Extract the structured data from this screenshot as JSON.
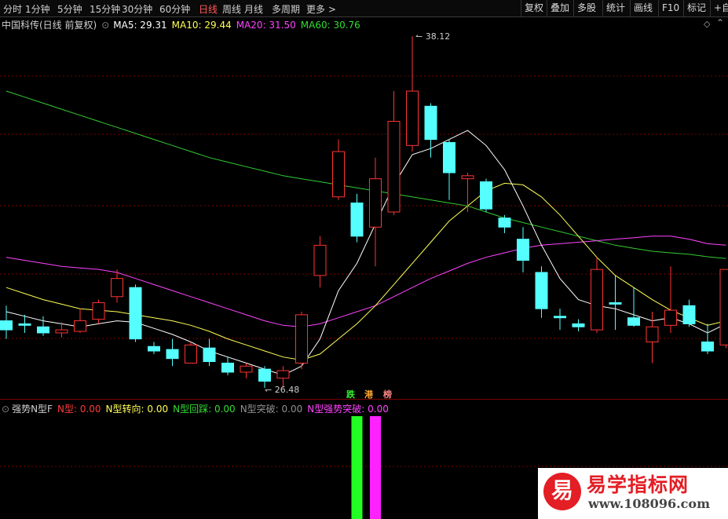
{
  "toolbar": {
    "periods": [
      "分时",
      "1分钟",
      "5分钟",
      "15分钟",
      "30分钟",
      "60分钟",
      "日线",
      "周线",
      "月线",
      "多周期",
      "更多 >"
    ],
    "active_period": "日线",
    "right_buttons": [
      "复权",
      "叠加",
      "多股",
      "统计",
      "画线",
      "F10",
      "标记",
      "+自"
    ]
  },
  "main_legend": {
    "title": "中国科传(日线 前复权)",
    "ma5": "MA5: 29.31",
    "ma10": "MA10: 29.44",
    "ma20": "MA20: 31.50",
    "ma60": "MA60: 30.76"
  },
  "annotations": {
    "high_label": "38.12",
    "low_label": "26.48",
    "markers": [
      "跌",
      "港",
      "榜"
    ]
  },
  "indicator_legend": {
    "name": "强势N型F",
    "items": [
      {
        "label": "N型:",
        "value": "0.00",
        "color": "#ff3b3b"
      },
      {
        "label": "N型转向:",
        "value": "0.00",
        "color": "#ffff55"
      },
      {
        "label": "N型回踩:",
        "value": "0.00",
        "color": "#33dd33"
      },
      {
        "label": "N型突破:",
        "value": "0.00",
        "color": "#909090"
      },
      {
        "label": "N型强势突破:",
        "value": "0.00",
        "color": "#ff44ff"
      }
    ]
  },
  "watermark": {
    "icon_char": "易",
    "title": "易学指标网",
    "url": "www.108096.com"
  },
  "colors": {
    "up": "#ff3333",
    "down": "#55ffff",
    "ma5": "#ffffff",
    "ma10": "#ffff55",
    "ma20": "#ff44ff",
    "ma60": "#33cc33",
    "grid": "#7a0000",
    "bar_green": "#22ff22",
    "bar_magenta": "#ff22ff"
  },
  "chart_data": {
    "type": "candlestick",
    "price_range": [
      26.48,
      38.12
    ],
    "candles": [
      {
        "o": 28.7,
        "h": 29.2,
        "l": 28.1,
        "c": 28.4
      },
      {
        "o": 28.6,
        "h": 28.9,
        "l": 28.3,
        "c": 28.55
      },
      {
        "o": 28.5,
        "h": 28.85,
        "l": 28.2,
        "c": 28.3
      },
      {
        "o": 28.3,
        "h": 28.65,
        "l": 28.15,
        "c": 28.4
      },
      {
        "o": 28.35,
        "h": 29.1,
        "l": 28.3,
        "c": 28.7
      },
      {
        "o": 28.75,
        "h": 29.4,
        "l": 28.6,
        "c": 29.3
      },
      {
        "o": 29.5,
        "h": 30.4,
        "l": 29.3,
        "c": 30.1
      },
      {
        "o": 29.8,
        "h": 29.9,
        "l": 28.0,
        "c": 28.1
      },
      {
        "o": 27.85,
        "h": 28.0,
        "l": 27.6,
        "c": 27.7
      },
      {
        "o": 27.75,
        "h": 28.1,
        "l": 27.2,
        "c": 27.45
      },
      {
        "o": 27.3,
        "h": 28.0,
        "l": 27.3,
        "c": 27.9
      },
      {
        "o": 27.8,
        "h": 28.1,
        "l": 27.2,
        "c": 27.35
      },
      {
        "o": 27.3,
        "h": 27.5,
        "l": 26.9,
        "c": 27.0
      },
      {
        "o": 27.0,
        "h": 27.3,
        "l": 26.8,
        "c": 27.2
      },
      {
        "o": 27.1,
        "h": 27.2,
        "l": 26.48,
        "c": 26.7
      },
      {
        "o": 26.8,
        "h": 27.2,
        "l": 26.48,
        "c": 27.05
      },
      {
        "o": 27.3,
        "h": 29.0,
        "l": 27.1,
        "c": 28.9
      },
      {
        "o": 30.2,
        "h": 31.5,
        "l": 29.8,
        "c": 31.2
      },
      {
        "o": 32.8,
        "h": 34.7,
        "l": 32.7,
        "c": 34.3
      },
      {
        "o": 32.6,
        "h": 32.9,
        "l": 31.3,
        "c": 31.5
      },
      {
        "o": 31.8,
        "h": 34.1,
        "l": 30.5,
        "c": 33.4
      },
      {
        "o": 32.3,
        "h": 36.3,
        "l": 32.2,
        "c": 35.3
      },
      {
        "o": 34.5,
        "h": 38.12,
        "l": 34.3,
        "c": 36.3
      },
      {
        "o": 35.8,
        "h": 35.9,
        "l": 34.1,
        "c": 34.7
      },
      {
        "o": 34.6,
        "h": 34.7,
        "l": 32.7,
        "c": 33.6
      },
      {
        "o": 33.4,
        "h": 33.6,
        "l": 32.3,
        "c": 33.5
      },
      {
        "o": 33.3,
        "h": 33.4,
        "l": 32.3,
        "c": 32.4
      },
      {
        "o": 32.1,
        "h": 32.2,
        "l": 31.6,
        "c": 31.8
      },
      {
        "o": 31.4,
        "h": 31.8,
        "l": 30.3,
        "c": 30.7
      },
      {
        "o": 30.3,
        "h": 30.5,
        "l": 28.8,
        "c": 29.1
      },
      {
        "o": 28.85,
        "h": 29.1,
        "l": 28.4,
        "c": 28.8
      },
      {
        "o": 28.6,
        "h": 28.75,
        "l": 28.35,
        "c": 28.5
      },
      {
        "o": 28.4,
        "h": 30.8,
        "l": 28.3,
        "c": 30.4
      },
      {
        "o": 29.3,
        "h": 30.2,
        "l": 28.4,
        "c": 29.25
      },
      {
        "o": 28.8,
        "h": 29.8,
        "l": 28.5,
        "c": 28.55
      },
      {
        "o": 28.0,
        "h": 29.0,
        "l": 27.3,
        "c": 28.5
      },
      {
        "o": 28.55,
        "h": 30.5,
        "l": 28.3,
        "c": 29.05
      },
      {
        "o": 29.2,
        "h": 29.4,
        "l": 28.5,
        "c": 28.6
      },
      {
        "o": 28.0,
        "h": 28.6,
        "l": 27.6,
        "c": 27.7
      },
      {
        "o": 27.9,
        "h": 30.4,
        "l": 27.8,
        "c": 30.4
      }
    ],
    "ma5": [
      29.0,
      28.85,
      28.7,
      28.6,
      28.5,
      28.6,
      28.7,
      28.65,
      28.45,
      28.25,
      28.0,
      27.7,
      27.5,
      27.3,
      27.1,
      26.9,
      27.2,
      28.1,
      29.7,
      30.6,
      31.9,
      33.2,
      34.2,
      34.4,
      34.7,
      35.0,
      34.5,
      33.7,
      32.5,
      31.2,
      30.1,
      29.4,
      29.2,
      29.1,
      28.9,
      28.7,
      28.8,
      28.6,
      28.3,
      28.6
    ],
    "ma10": [
      29.8,
      29.6,
      29.4,
      29.25,
      29.1,
      29.05,
      29.0,
      28.9,
      28.8,
      28.7,
      28.55,
      28.35,
      28.1,
      27.9,
      27.7,
      27.5,
      27.4,
      27.6,
      28.1,
      28.6,
      29.2,
      29.9,
      30.6,
      31.3,
      32.0,
      32.5,
      33.0,
      33.25,
      33.2,
      32.8,
      32.2,
      31.5,
      30.8,
      30.2,
      29.8,
      29.4,
      29.05,
      28.8,
      28.55,
      28.7
    ],
    "ma20": [
      30.8,
      30.7,
      30.6,
      30.5,
      30.45,
      30.4,
      30.3,
      30.1,
      29.9,
      29.7,
      29.5,
      29.3,
      29.1,
      28.9,
      28.7,
      28.55,
      28.5,
      28.6,
      28.8,
      29.0,
      29.2,
      29.5,
      29.8,
      30.1,
      30.35,
      30.6,
      30.8,
      30.95,
      31.1,
      31.2,
      31.25,
      31.3,
      31.35,
      31.4,
      31.45,
      31.5,
      31.5,
      31.4,
      31.25,
      31.2
    ],
    "ma60": [
      36.3,
      36.1,
      35.9,
      35.7,
      35.5,
      35.3,
      35.1,
      34.9,
      34.7,
      34.5,
      34.3,
      34.1,
      33.95,
      33.8,
      33.65,
      33.5,
      33.4,
      33.3,
      33.2,
      33.1,
      33.0,
      32.9,
      32.8,
      32.7,
      32.6,
      32.5,
      32.3,
      32.1,
      31.95,
      31.8,
      31.65,
      31.5,
      31.35,
      31.2,
      31.1,
      31.0,
      30.95,
      30.9,
      30.82,
      30.76
    ],
    "indicator_bars": [
      {
        "candle_index": 19,
        "color": "#22ff22",
        "value": 1
      },
      {
        "candle_index": 20,
        "color": "#ff22ff",
        "value": 1
      }
    ]
  }
}
